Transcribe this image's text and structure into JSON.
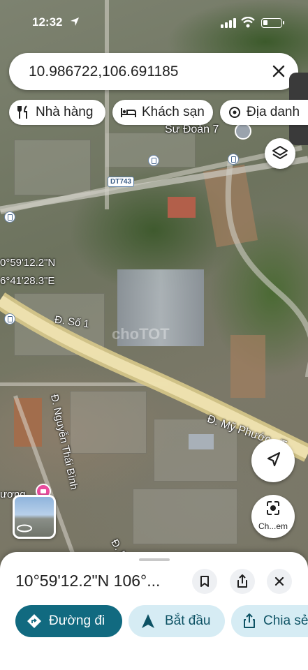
{
  "status_bar": {
    "time": "12:32"
  },
  "search": {
    "value": "10.986722,106.691185"
  },
  "chips": [
    {
      "label": "Nhà hàng",
      "icon": "fork-knife-icon"
    },
    {
      "label": "Khách sạn",
      "icon": "bed-icon"
    },
    {
      "label": "Địa danh",
      "icon": "landmark-icon"
    }
  ],
  "map": {
    "place_label": "Sư Đoàn 7",
    "route_shield": "DT743",
    "coord_lat": "0°59'12.2\"N",
    "coord_lng": "6°41'28.3\"E",
    "street_so1": "Đ. Số 1",
    "street_my_phuoc": "Đ. Mỹ Phước - T",
    "street_nguyen_thai_binh": "Đ. Nguyễn Thái Bình",
    "street_ng": "Đ. Ngu",
    "poi_fragment": "ương",
    "watermark": "choTOT"
  },
  "lens": {
    "label": "Ch...em"
  },
  "sheet": {
    "title": "10°59'12.2\"N 106°...",
    "actions": [
      {
        "label": "Đường đi",
        "icon": "directions-icon"
      },
      {
        "label": "Bắt đầu",
        "icon": "navigation-arrow-icon"
      },
      {
        "label": "Chia sẻ",
        "icon": "share-icon"
      }
    ]
  },
  "colors": {
    "primary": "#116a80",
    "secondary_bg": "#d6ecf4",
    "route_yellow": "#e3d49a"
  }
}
